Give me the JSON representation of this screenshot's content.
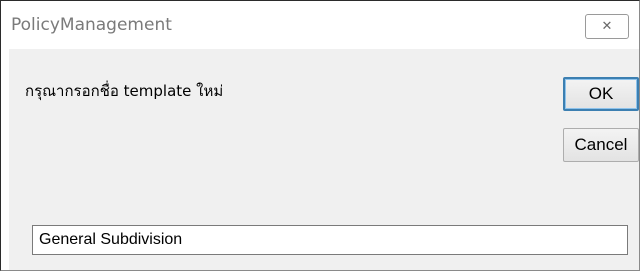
{
  "window": {
    "title": "PolicyManagement",
    "close_glyph": "✕"
  },
  "dialog": {
    "prompt": "กรุณากรอกชื่อ template ใหม่",
    "ok_label": "OK",
    "cancel_label": "Cancel"
  },
  "input": {
    "value": "General Subdivision",
    "placeholder": ""
  }
}
